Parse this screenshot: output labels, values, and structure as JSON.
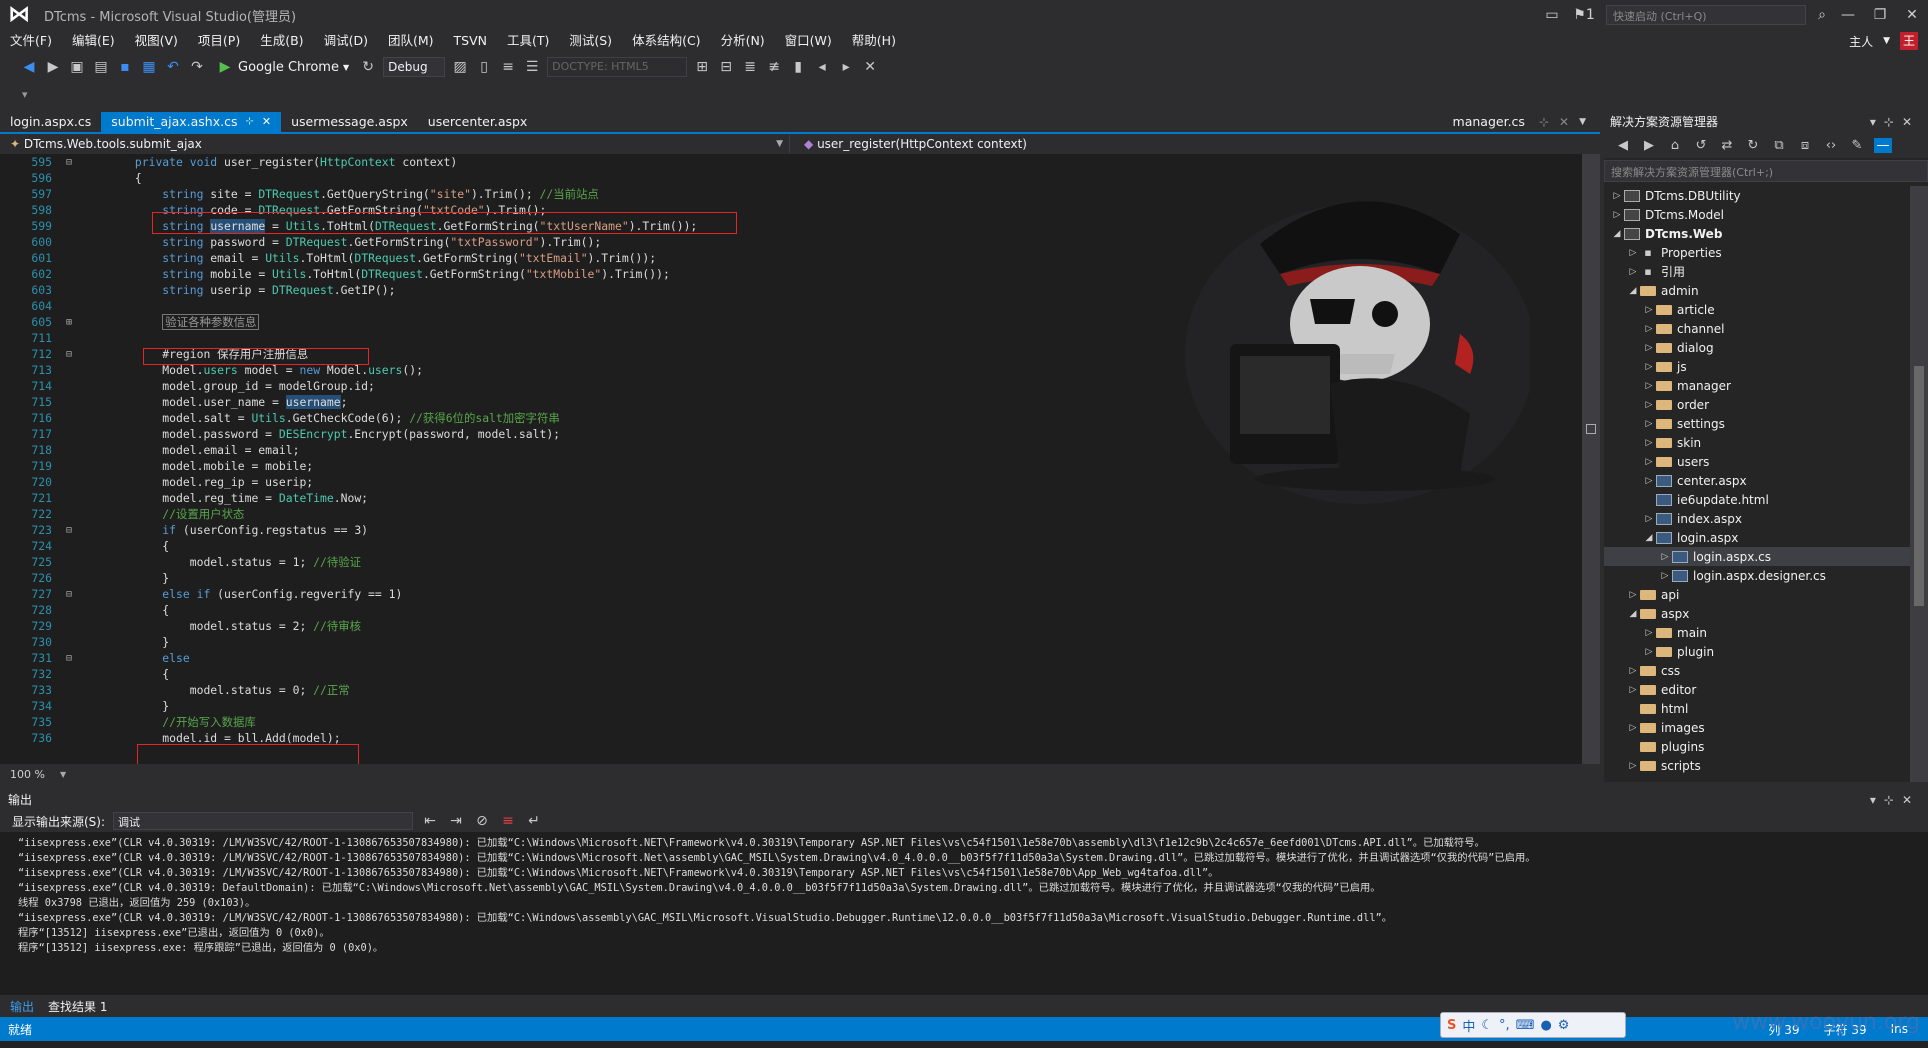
{
  "window": {
    "title": "DTcms - Microsoft Visual Studio(管理员)",
    "quick_launch": "快速启动 (Ctrl+Q)",
    "flag_count": "1"
  },
  "menu": [
    "文件(F)",
    "编辑(E)",
    "视图(V)",
    "项目(P)",
    "生成(B)",
    "调试(D)",
    "团队(M)",
    "TSVN",
    "工具(T)",
    "测试(S)",
    "体系结构(C)",
    "分析(N)",
    "窗口(W)",
    "帮助(H)"
  ],
  "user": {
    "name": "主人",
    "avatar": "王"
  },
  "toolbar": {
    "run_target": "Google Chrome",
    "config": "Debug",
    "doctype": "DOCTYPE: HTML5"
  },
  "tabs": {
    "items": [
      {
        "label": "login.aspx.cs"
      },
      {
        "label": "submit_ajax.ashx.cs"
      },
      {
        "label": "usermessage.aspx"
      },
      {
        "label": "usercenter.aspx"
      }
    ],
    "right": "manager.cs"
  },
  "navbar": {
    "left": "DTcms.Web.tools.submit_ajax",
    "right": "user_register(HttpContext context)"
  },
  "editor": {
    "zoom": "100 %",
    "lines": [
      {
        "n": "595",
        "g": "minus",
        "segs": [
          {
            "t": "        "
          },
          {
            "t": "private void",
            "c": "kw"
          },
          {
            "t": " user_register("
          },
          {
            "t": "HttpContext",
            "c": "tp"
          },
          {
            "t": " context)"
          }
        ]
      },
      {
        "n": "596",
        "g": "",
        "segs": [
          {
            "t": "        {"
          }
        ]
      },
      {
        "n": "597",
        "g": "",
        "segs": [
          {
            "t": "            "
          },
          {
            "t": "string",
            "c": "kw"
          },
          {
            "t": " site = "
          },
          {
            "t": "DTRequest",
            "c": "tp"
          },
          {
            "t": ".GetQueryString("
          },
          {
            "t": "\"site\"",
            "c": "str"
          },
          {
            "t": ").Trim(); "
          },
          {
            "t": "//当前站点",
            "c": "cm"
          }
        ]
      },
      {
        "n": "598",
        "g": "",
        "segs": [
          {
            "t": "            "
          },
          {
            "t": "string",
            "c": "kw"
          },
          {
            "t": " code = "
          },
          {
            "t": "DTRequest",
            "c": "tp"
          },
          {
            "t": ".GetFormString("
          },
          {
            "t": "\"txtCode\"",
            "c": "str"
          },
          {
            "t": ").Trim();"
          }
        ]
      },
      {
        "n": "599",
        "g": "",
        "segs": [
          {
            "t": "            "
          },
          {
            "t": "string",
            "c": "kw"
          },
          {
            "t": " "
          },
          {
            "t": "username",
            "c": "hl"
          },
          {
            "t": " = "
          },
          {
            "t": "Utils",
            "c": "tp"
          },
          {
            "t": ".ToHtml("
          },
          {
            "t": "DTRequest",
            "c": "tp"
          },
          {
            "t": ".GetFormString("
          },
          {
            "t": "\"txtUserName\"",
            "c": "str"
          },
          {
            "t": ").Trim());"
          }
        ]
      },
      {
        "n": "600",
        "g": "",
        "segs": [
          {
            "t": "            "
          },
          {
            "t": "string",
            "c": "kw"
          },
          {
            "t": " password = "
          },
          {
            "t": "DTRequest",
            "c": "tp"
          },
          {
            "t": ".GetFormString("
          },
          {
            "t": "\"txtPassword\"",
            "c": "str"
          },
          {
            "t": ").Trim();"
          }
        ]
      },
      {
        "n": "601",
        "g": "",
        "segs": [
          {
            "t": "            "
          },
          {
            "t": "string",
            "c": "kw"
          },
          {
            "t": " email = "
          },
          {
            "t": "Utils",
            "c": "tp"
          },
          {
            "t": ".ToHtml("
          },
          {
            "t": "DTRequest",
            "c": "tp"
          },
          {
            "t": ".GetFormString("
          },
          {
            "t": "\"txtEmail\"",
            "c": "str"
          },
          {
            "t": ").Trim());"
          }
        ]
      },
      {
        "n": "602",
        "g": "",
        "segs": [
          {
            "t": "            "
          },
          {
            "t": "string",
            "c": "kw"
          },
          {
            "t": " mobile = "
          },
          {
            "t": "Utils",
            "c": "tp"
          },
          {
            "t": ".ToHtml("
          },
          {
            "t": "DTRequest",
            "c": "tp"
          },
          {
            "t": ".GetFormString("
          },
          {
            "t": "\"txtMobile\"",
            "c": "str"
          },
          {
            "t": ").Trim());"
          }
        ]
      },
      {
        "n": "603",
        "g": "",
        "segs": [
          {
            "t": "            "
          },
          {
            "t": "string",
            "c": "kw"
          },
          {
            "t": " userip = "
          },
          {
            "t": "DTRequest",
            "c": "tp"
          },
          {
            "t": ".GetIP();"
          }
        ]
      },
      {
        "n": "604",
        "g": "",
        "segs": [
          {
            "t": ""
          }
        ]
      },
      {
        "n": "605",
        "g": "plus",
        "segs": [
          {
            "t": "            "
          },
          {
            "t": "验证各种参数信息",
            "c": "region"
          }
        ]
      },
      {
        "n": "711",
        "g": "",
        "segs": [
          {
            "t": ""
          }
        ]
      },
      {
        "n": "712",
        "g": "minus",
        "segs": [
          {
            "t": "            #region 保存用户注册信息"
          }
        ]
      },
      {
        "n": "713",
        "g": "",
        "segs": [
          {
            "t": "            Model."
          },
          {
            "t": "users",
            "c": "tp"
          },
          {
            "t": " model = "
          },
          {
            "t": "new",
            "c": "kw"
          },
          {
            "t": " Model."
          },
          {
            "t": "users",
            "c": "tp"
          },
          {
            "t": "();"
          }
        ]
      },
      {
        "n": "714",
        "g": "",
        "segs": [
          {
            "t": "            model.group_id = modelGroup.id;"
          }
        ]
      },
      {
        "n": "715",
        "g": "",
        "segs": [
          {
            "t": "            model.user_name = "
          },
          {
            "t": "username",
            "c": "hl"
          },
          {
            "t": ";"
          }
        ]
      },
      {
        "n": "716",
        "g": "",
        "segs": [
          {
            "t": "            model.salt = "
          },
          {
            "t": "Utils",
            "c": "tp"
          },
          {
            "t": ".GetCheckCode(6); "
          },
          {
            "t": "//获得6位的salt加密字符串",
            "c": "cm"
          }
        ]
      },
      {
        "n": "717",
        "g": "",
        "segs": [
          {
            "t": "            model.password = "
          },
          {
            "t": "DESEncrypt",
            "c": "tp"
          },
          {
            "t": ".Encrypt(password, model.salt);"
          }
        ]
      },
      {
        "n": "718",
        "g": "",
        "segs": [
          {
            "t": "            model.email = email;"
          }
        ]
      },
      {
        "n": "719",
        "g": "",
        "segs": [
          {
            "t": "            model.mobile = mobile;"
          }
        ]
      },
      {
        "n": "720",
        "g": "",
        "segs": [
          {
            "t": "            model.reg_ip = userip;"
          }
        ]
      },
      {
        "n": "721",
        "g": "",
        "segs": [
          {
            "t": "            model.reg_time = "
          },
          {
            "t": "DateTime",
            "c": "tp"
          },
          {
            "t": ".Now;"
          }
        ]
      },
      {
        "n": "722",
        "g": "",
        "segs": [
          {
            "t": "            "
          },
          {
            "t": "//设置用户状态",
            "c": "cm"
          }
        ]
      },
      {
        "n": "723",
        "g": "minus",
        "segs": [
          {
            "t": "            "
          },
          {
            "t": "if",
            "c": "kw"
          },
          {
            "t": " (userConfig.regstatus == 3)"
          }
        ]
      },
      {
        "n": "724",
        "g": "",
        "segs": [
          {
            "t": "            {"
          }
        ]
      },
      {
        "n": "725",
        "g": "",
        "segs": [
          {
            "t": "                model.status = 1; "
          },
          {
            "t": "//待验证",
            "c": "cm"
          }
        ]
      },
      {
        "n": "726",
        "g": "",
        "segs": [
          {
            "t": "            }"
          }
        ]
      },
      {
        "n": "727",
        "g": "minus",
        "segs": [
          {
            "t": "            "
          },
          {
            "t": "else if",
            "c": "kw"
          },
          {
            "t": " (userConfig.regverify == 1)"
          }
        ]
      },
      {
        "n": "728",
        "g": "",
        "segs": [
          {
            "t": "            {"
          }
        ]
      },
      {
        "n": "729",
        "g": "",
        "segs": [
          {
            "t": "                model.status = 2; "
          },
          {
            "t": "//待审核",
            "c": "cm"
          }
        ]
      },
      {
        "n": "730",
        "g": "",
        "segs": [
          {
            "t": "            }"
          }
        ]
      },
      {
        "n": "731",
        "g": "minus",
        "segs": [
          {
            "t": "            "
          },
          {
            "t": "else",
            "c": "kw"
          }
        ]
      },
      {
        "n": "732",
        "g": "",
        "segs": [
          {
            "t": "            {"
          }
        ]
      },
      {
        "n": "733",
        "g": "",
        "segs": [
          {
            "t": "                model.status = 0; "
          },
          {
            "t": "//正常",
            "c": "cm"
          }
        ]
      },
      {
        "n": "734",
        "g": "",
        "segs": [
          {
            "t": "            }"
          }
        ]
      },
      {
        "n": "735",
        "g": "",
        "segs": [
          {
            "t": "            "
          },
          {
            "t": "//开始写入数据库",
            "c": "cm"
          }
        ]
      },
      {
        "n": "736",
        "g": "",
        "segs": [
          {
            "t": "            model.id = bll.Add(model);"
          }
        ]
      }
    ]
  },
  "solution_explorer": {
    "title": "解决方案资源管理器",
    "search_placeholder": "搜索解决方案资源管理器(Ctrl+;)",
    "items": [
      {
        "label": "DTcms.DBUtility",
        "level": 0,
        "arrow": "right",
        "icon": "proj"
      },
      {
        "label": "DTcms.Model",
        "level": 0,
        "arrow": "right",
        "icon": "proj"
      },
      {
        "label": "DTcms.Web",
        "level": 0,
        "arrow": "down",
        "icon": "proj",
        "bold": true
      },
      {
        "label": "Properties",
        "level": 1,
        "arrow": "right",
        "icon": "prop"
      },
      {
        "label": "引用",
        "level": 1,
        "arrow": "right",
        "icon": "prop"
      },
      {
        "label": "admin",
        "level": 1,
        "arrow": "down",
        "icon": "folder"
      },
      {
        "label": "article",
        "level": 2,
        "arrow": "right",
        "icon": "folder"
      },
      {
        "label": "channel",
        "level": 2,
        "arrow": "right",
        "icon": "folder"
      },
      {
        "label": "dialog",
        "level": 2,
        "arrow": "right",
        "icon": "folder"
      },
      {
        "label": "js",
        "level": 2,
        "arrow": "right",
        "icon": "folder"
      },
      {
        "label": "manager",
        "level": 2,
        "arrow": "right",
        "icon": "folder"
      },
      {
        "label": "order",
        "level": 2,
        "arrow": "right",
        "icon": "folder"
      },
      {
        "label": "settings",
        "level": 2,
        "arrow": "right",
        "icon": "folder"
      },
      {
        "label": "skin",
        "level": 2,
        "arrow": "right",
        "icon": "folder"
      },
      {
        "label": "users",
        "level": 2,
        "arrow": "right",
        "icon": "folder"
      },
      {
        "label": "center.aspx",
        "level": 2,
        "arrow": "right",
        "icon": "file"
      },
      {
        "label": "ie6update.html",
        "level": 2,
        "arrow": "",
        "icon": "file"
      },
      {
        "label": "index.aspx",
        "level": 2,
        "arrow": "right",
        "icon": "file"
      },
      {
        "label": "login.aspx",
        "level": 2,
        "arrow": "down",
        "icon": "file"
      },
      {
        "label": "login.aspx.cs",
        "level": 3,
        "arrow": "right",
        "icon": "file",
        "selected": true
      },
      {
        "label": "login.aspx.designer.cs",
        "level": 3,
        "arrow": "right",
        "icon": "file"
      },
      {
        "label": "api",
        "level": 1,
        "arrow": "right",
        "icon": "folder"
      },
      {
        "label": "aspx",
        "level": 1,
        "arrow": "down",
        "icon": "folder"
      },
      {
        "label": "main",
        "level": 2,
        "arrow": "right",
        "icon": "folder"
      },
      {
        "label": "plugin",
        "level": 2,
        "arrow": "right",
        "icon": "folder"
      },
      {
        "label": "css",
        "level": 1,
        "arrow": "right",
        "icon": "folder"
      },
      {
        "label": "editor",
        "level": 1,
        "arrow": "right",
        "icon": "folder"
      },
      {
        "label": "html",
        "level": 1,
        "arrow": "",
        "icon": "folder"
      },
      {
        "label": "images",
        "level": 1,
        "arrow": "right",
        "icon": "folder"
      },
      {
        "label": "plugins",
        "level": 1,
        "arrow": "",
        "icon": "folder"
      },
      {
        "label": "scripts",
        "level": 1,
        "arrow": "right",
        "icon": "folder"
      }
    ]
  },
  "output": {
    "title": "输出",
    "source_label": "显示输出来源(S):",
    "source_value": "调试",
    "lines": [
      "“iisexpress.exe”(CLR v4.0.30319: /LM/W3SVC/42/ROOT-1-130867653507834980): 已加载“C:\\Windows\\Microsoft.NET\\Framework\\v4.0.30319\\Temporary ASP.NET Files\\vs\\c54f1501\\1e58e70b\\assembly\\dl3\\f1e12c9b\\2c4c657e_6eefd001\\DTcms.API.dll”。已加载符号。",
      "“iisexpress.exe”(CLR v4.0.30319: /LM/W3SVC/42/ROOT-1-130867653507834980): 已加载“C:\\Windows\\Microsoft.Net\\assembly\\GAC_MSIL\\System.Drawing\\v4.0_4.0.0.0__b03f5f7f11d50a3a\\System.Drawing.dll”。已跳过加载符号。模块进行了优化，并且调试器选项“仅我的代码”已启用。",
      "“iisexpress.exe”(CLR v4.0.30319: /LM/W3SVC/42/ROOT-1-130867653507834980): 已加载“C:\\Windows\\Microsoft.NET\\Framework\\v4.0.30319\\Temporary ASP.NET Files\\vs\\c54f1501\\1e58e70b\\App_Web_wg4tafoa.dll”。",
      "“iisexpress.exe”(CLR v4.0.30319: DefaultDomain): 已加载“C:\\Windows\\Microsoft.Net\\assembly\\GAC_MSIL\\System.Drawing\\v4.0_4.0.0.0__b03f5f7f11d50a3a\\System.Drawing.dll”。已跳过加载符号。模块进行了优化，并且调试器选项“仅我的代码”已启用。",
      "线程 0x3798 已退出，返回值为 259 (0x103)。",
      "“iisexpress.exe”(CLR v4.0.30319: /LM/W3SVC/42/ROOT-1-130867653507834980): 已加载“C:\\Windows\\assembly\\GAC_MSIL\\Microsoft.VisualStudio.Debugger.Runtime\\12.0.0.0__b03f5f7f11d50a3a\\Microsoft.VisualStudio.Debugger.Runtime.dll”。",
      "程序“[13512] iisexpress.exe”已退出，返回值为 0 (0x0)。",
      "程序“[13512] iisexpress.exe: 程序跟踪”已退出，返回值为 0 (0x0)。"
    ],
    "tabs": [
      "输出",
      "查找结果 1"
    ]
  },
  "status": {
    "left": "就绪",
    "col": "列 39",
    "char": "字符 39",
    "mode": "Ins"
  },
  "ime": {
    "label": "中"
  },
  "watermark": "www.wooyun.org",
  "colors": {
    "accent": "#007acc",
    "background": "#1e1e1e",
    "chrome": "#2d2d30",
    "annotation": "#e4262a"
  }
}
